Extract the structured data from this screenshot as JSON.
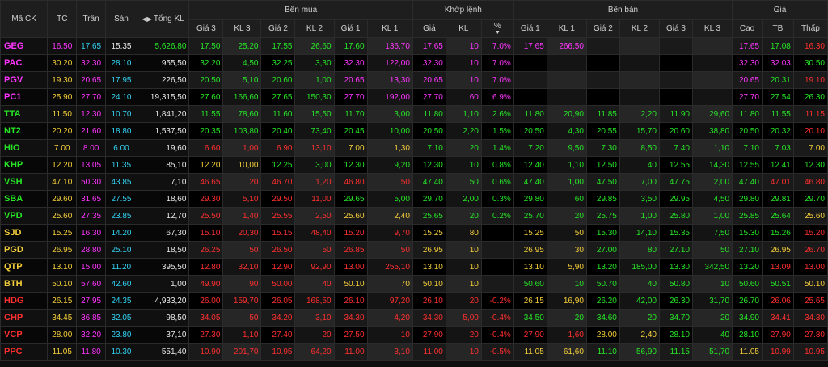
{
  "colors": {
    "ceiling": "#ff35ff",
    "down": "#ff2f2f",
    "up": "#26e626",
    "ref": "#f5cf3a",
    "floor": "#32d2f2"
  },
  "icons": {
    "sort": "sort-triangle-icon",
    "pct_sort": "arrow-down-icon"
  },
  "headers": {
    "symbol": "Mã CK",
    "tc": "TC",
    "tran": "Trần",
    "san": "Sàn",
    "tong_kl": "Tổng KL",
    "buy_group": "Bên mua",
    "match_group": "Khớp lệnh",
    "sell_group": "Bên bán",
    "price_group": "Giá",
    "buy": {
      "gia3": "Giá 3",
      "kl3": "KL 3",
      "gia2": "Giá 2",
      "kl2": "KL 2",
      "gia1": "Giá 1",
      "kl1": "KL 1"
    },
    "match": {
      "gia": "Giá",
      "kl": "KL",
      "pct": "%"
    },
    "sell": {
      "gia1": "Giá 1",
      "kl1": "KL 1",
      "gia2": "Giá 2",
      "kl2": "KL 2",
      "gia3": "Giá 3",
      "kl3": "KL 3"
    },
    "price": {
      "cao": "Cao",
      "tb": "TB",
      "thap": "Thấp"
    }
  },
  "rows": [
    {
      "sym": "GEG",
      "tc": "16.50",
      "tran": "17.65",
      "san": "15.35",
      "tkl": "5,626,80",
      "b3": "17.50",
      "bk3": "25,20",
      "b2": "17.55",
      "bk2": "26,60",
      "b1": "17.60",
      "bk1": "136,70",
      "mp": "17.65",
      "mk": "10",
      "pct": "7.0%",
      "s1": "17.65",
      "sk1": "266,50",
      "s2": "",
      "sk2": "",
      "s3": "",
      "sk3": "",
      "hi": "17.65",
      "avg": "17.08",
      "lo": "16.30",
      "cc": [
        "P",
        "P",
        "C",
        "W",
        "G",
        "G",
        "G",
        "G",
        "G",
        "G",
        "P",
        "P",
        "P",
        "P",
        "P",
        "P",
        "",
        "",
        "",
        "",
        "P",
        "G",
        "R"
      ]
    },
    {
      "sym": "PAC",
      "tc": "30.20",
      "tran": "32.30",
      "san": "28.10",
      "tkl": "955,50",
      "b3": "32.20",
      "bk3": "4,50",
      "b2": "32.25",
      "bk2": "3,30",
      "b1": "32.30",
      "bk1": "122,00",
      "mp": "32.30",
      "mk": "10",
      "pct": "7.0%",
      "s1": "",
      "sk1": "",
      "s2": "",
      "sk2": "",
      "s3": "",
      "sk3": "",
      "hi": "32.30",
      "avg": "32.03",
      "lo": "30.50",
      "cc": [
        "P",
        "Y",
        "P",
        "C",
        "W",
        "G",
        "G",
        "G",
        "G",
        "P",
        "P",
        "P",
        "P",
        "P",
        "",
        "",
        "",
        "",
        "",
        "",
        "P",
        "P",
        "G"
      ]
    },
    {
      "sym": "PGV",
      "tc": "19.30",
      "tran": "20.65",
      "san": "17.95",
      "tkl": "226,50",
      "b3": "20.50",
      "bk3": "5,10",
      "b2": "20.60",
      "bk2": "1,00",
      "b1": "20.65",
      "bk1": "13,30",
      "mp": "20.65",
      "mk": "10",
      "pct": "7.0%",
      "s1": "",
      "sk1": "",
      "s2": "",
      "sk2": "",
      "s3": "",
      "sk3": "",
      "hi": "20.65",
      "avg": "20.31",
      "lo": "19.10",
      "cc": [
        "P",
        "Y",
        "P",
        "C",
        "W",
        "G",
        "G",
        "G",
        "G",
        "P",
        "P",
        "P",
        "P",
        "P",
        "",
        "",
        "",
        "",
        "",
        "",
        "P",
        "G",
        "R"
      ]
    },
    {
      "sym": "PC1",
      "tc": "25.90",
      "tran": "27.70",
      "san": "24.10",
      "tkl": "19,315,50",
      "b3": "27.60",
      "bk3": "166,60",
      "b2": "27.65",
      "bk2": "150,30",
      "b1": "27.70",
      "bk1": "192,00",
      "mp": "27.70",
      "mk": "60",
      "pct": "6.9%",
      "s1": "",
      "sk1": "",
      "s2": "",
      "sk2": "",
      "s3": "",
      "sk3": "",
      "hi": "27.70",
      "avg": "27.54",
      "lo": "26.30",
      "cc": [
        "P",
        "Y",
        "P",
        "C",
        "W",
        "G",
        "G",
        "G",
        "G",
        "P",
        "P",
        "P",
        "P",
        "P",
        "",
        "",
        "",
        "",
        "",
        "",
        "P",
        "G",
        "G"
      ]
    },
    {
      "sym": "TTA",
      "tc": "11.50",
      "tran": "12.30",
      "san": "10.70",
      "tkl": "1,841,20",
      "b3": "11.55",
      "bk3": "78,60",
      "b2": "11.60",
      "bk2": "15,50",
      "b1": "11.70",
      "bk1": "3,00",
      "mp": "11.80",
      "mk": "1,10",
      "pct": "2.6%",
      "s1": "11.80",
      "sk1": "20,90",
      "s2": "11.85",
      "sk2": "2,20",
      "s3": "11.90",
      "sk3": "29,60",
      "hi": "11.80",
      "avg": "11.55",
      "lo": "11.15",
      "cc": [
        "G",
        "Y",
        "P",
        "C",
        "W",
        "G",
        "G",
        "G",
        "G",
        "G",
        "G",
        "G",
        "G",
        "G",
        "G",
        "G",
        "G",
        "G",
        "G",
        "G",
        "G",
        "G",
        "R"
      ]
    },
    {
      "sym": "NT2",
      "tc": "20.20",
      "tran": "21.60",
      "san": "18.80",
      "tkl": "1,537,50",
      "b3": "20.35",
      "bk3": "103,80",
      "b2": "20.40",
      "bk2": "73,40",
      "b1": "20.45",
      "bk1": "10,00",
      "mp": "20.50",
      "mk": "2,20",
      "pct": "1.5%",
      "s1": "20.50",
      "sk1": "4,30",
      "s2": "20.55",
      "sk2": "15,70",
      "s3": "20.60",
      "sk3": "38,80",
      "hi": "20.50",
      "avg": "20.32",
      "lo": "20.10",
      "cc": [
        "G",
        "Y",
        "P",
        "C",
        "W",
        "G",
        "G",
        "G",
        "G",
        "G",
        "G",
        "G",
        "G",
        "G",
        "G",
        "G",
        "G",
        "G",
        "G",
        "G",
        "G",
        "G",
        "R"
      ]
    },
    {
      "sym": "HIO",
      "tc": "7.00",
      "tran": "8.00",
      "san": "6.00",
      "tkl": "19,60",
      "b3": "6.60",
      "bk3": "1,00",
      "b2": "6.90",
      "bk2": "13,10",
      "b1": "7.00",
      "bk1": "1,30",
      "mp": "7.10",
      "mk": "20",
      "pct": "1.4%",
      "s1": "7.20",
      "sk1": "9,50",
      "s2": "7.30",
      "sk2": "8,50",
      "s3": "7.40",
      "sk3": "1,10",
      "hi": "7.10",
      "avg": "7.03",
      "lo": "7.00",
      "cc": [
        "G",
        "Y",
        "P",
        "C",
        "W",
        "R",
        "R",
        "R",
        "R",
        "Y",
        "Y",
        "G",
        "G",
        "G",
        "G",
        "G",
        "G",
        "G",
        "G",
        "G",
        "G",
        "G",
        "Y"
      ]
    },
    {
      "sym": "KHP",
      "tc": "12.20",
      "tran": "13.05",
      "san": "11.35",
      "tkl": "85,10",
      "b3": "12.20",
      "bk3": "10,00",
      "b2": "12.25",
      "bk2": "3,00",
      "b1": "12.30",
      "bk1": "9,20",
      "mp": "12.30",
      "mk": "10",
      "pct": "0.8%",
      "s1": "12.40",
      "sk1": "1,10",
      "s2": "12.50",
      "sk2": "40",
      "s3": "12.55",
      "sk3": "14,30",
      "hi": "12.55",
      "avg": "12.41",
      "lo": "12.30",
      "cc": [
        "G",
        "Y",
        "P",
        "C",
        "W",
        "Y",
        "Y",
        "G",
        "G",
        "G",
        "G",
        "G",
        "G",
        "G",
        "G",
        "G",
        "G",
        "G",
        "G",
        "G",
        "G",
        "G",
        "G"
      ]
    },
    {
      "sym": "VSH",
      "tc": "47.10",
      "tran": "50.30",
      "san": "43.85",
      "tkl": "7,10",
      "b3": "46.65",
      "bk3": "20",
      "b2": "46.70",
      "bk2": "1,20",
      "b1": "46.80",
      "bk1": "50",
      "mp": "47.40",
      "mk": "50",
      "pct": "0.6%",
      "s1": "47.40",
      "sk1": "1,00",
      "s2": "47.50",
      "sk2": "7,00",
      "s3": "47.75",
      "sk3": "2,00",
      "hi": "47.40",
      "avg": "47.01",
      "lo": "46.80",
      "cc": [
        "G",
        "Y",
        "P",
        "C",
        "W",
        "R",
        "R",
        "R",
        "R",
        "R",
        "R",
        "G",
        "G",
        "G",
        "G",
        "G",
        "G",
        "G",
        "G",
        "G",
        "G",
        "R",
        "R"
      ]
    },
    {
      "sym": "SBA",
      "tc": "29.60",
      "tran": "31.65",
      "san": "27.55",
      "tkl": "18,60",
      "b3": "29.30",
      "bk3": "5,10",
      "b2": "29.50",
      "bk2": "11,00",
      "b1": "29.65",
      "bk1": "5,00",
      "mp": "29.70",
      "mk": "2,00",
      "pct": "0.3%",
      "s1": "29.80",
      "sk1": "60",
      "s2": "29.85",
      "sk2": "3,50",
      "s3": "29.95",
      "sk3": "4,50",
      "hi": "29.80",
      "avg": "29.81",
      "lo": "29.70",
      "cc": [
        "G",
        "Y",
        "P",
        "C",
        "W",
        "R",
        "R",
        "R",
        "R",
        "G",
        "G",
        "G",
        "G",
        "G",
        "G",
        "G",
        "G",
        "G",
        "G",
        "G",
        "G",
        "G",
        "G"
      ]
    },
    {
      "sym": "VPD",
      "tc": "25.60",
      "tran": "27.35",
      "san": "23.85",
      "tkl": "12,70",
      "b3": "25.50",
      "bk3": "1,40",
      "b2": "25.55",
      "bk2": "2,50",
      "b1": "25.60",
      "bk1": "2,40",
      "mp": "25.65",
      "mk": "20",
      "pct": "0.2%",
      "s1": "25.70",
      "sk1": "20",
      "s2": "25.75",
      "sk2": "1,00",
      "s3": "25.80",
      "sk3": "1,00",
      "hi": "25.85",
      "avg": "25.64",
      "lo": "25.60",
      "cc": [
        "G",
        "Y",
        "P",
        "C",
        "W",
        "R",
        "R",
        "R",
        "R",
        "Y",
        "Y",
        "G",
        "G",
        "G",
        "G",
        "G",
        "G",
        "G",
        "G",
        "G",
        "G",
        "G",
        "Y"
      ]
    },
    {
      "sym": "SJD",
      "tc": "15.25",
      "tran": "16.30",
      "san": "14.20",
      "tkl": "67,30",
      "b3": "15.10",
      "bk3": "20,30",
      "b2": "15.15",
      "bk2": "48,40",
      "b1": "15.20",
      "bk1": "9,70",
      "mp": "15.25",
      "mk": "80",
      "pct": "",
      "s1": "15.25",
      "sk1": "50",
      "s2": "15.30",
      "sk2": "14,10",
      "s3": "15.35",
      "sk3": "7,50",
      "hi": "15.30",
      "avg": "15.26",
      "lo": "15.20",
      "cc": [
        "Y",
        "Y",
        "P",
        "C",
        "W",
        "R",
        "R",
        "R",
        "R",
        "R",
        "R",
        "Y",
        "Y",
        "Y",
        "Y",
        "Y",
        "G",
        "G",
        "G",
        "G",
        "G",
        "G",
        "R"
      ]
    },
    {
      "sym": "PGD",
      "tc": "26.95",
      "tran": "28.80",
      "san": "25.10",
      "tkl": "18,50",
      "b3": "26.25",
      "bk3": "50",
      "b2": "26.50",
      "bk2": "50",
      "b1": "26.85",
      "bk1": "50",
      "mp": "26.95",
      "mk": "10",
      "pct": "",
      "s1": "26.95",
      "sk1": "30",
      "s2": "27.00",
      "sk2": "80",
      "s3": "27.10",
      "sk3": "50",
      "hi": "27.10",
      "avg": "26.95",
      "lo": "26.70",
      "cc": [
        "Y",
        "Y",
        "P",
        "C",
        "W",
        "R",
        "R",
        "R",
        "R",
        "R",
        "R",
        "Y",
        "Y",
        "Y",
        "Y",
        "Y",
        "G",
        "G",
        "G",
        "G",
        "G",
        "Y",
        "R"
      ]
    },
    {
      "sym": "QTP",
      "tc": "13.10",
      "tran": "15.00",
      "san": "11.20",
      "tkl": "395,50",
      "b3": "12.80",
      "bk3": "32,10",
      "b2": "12.90",
      "bk2": "92,90",
      "b1": "13.00",
      "bk1": "255,10",
      "mp": "13.10",
      "mk": "10",
      "pct": "",
      "s1": "13.10",
      "sk1": "5,90",
      "s2": "13.20",
      "sk2": "185,00",
      "s3": "13.30",
      "sk3": "342,50",
      "hi": "13.20",
      "avg": "13.09",
      "lo": "13.00",
      "cc": [
        "Y",
        "Y",
        "P",
        "C",
        "W",
        "R",
        "R",
        "R",
        "R",
        "R",
        "R",
        "Y",
        "Y",
        "Y",
        "Y",
        "Y",
        "G",
        "G",
        "G",
        "G",
        "G",
        "R",
        "R"
      ]
    },
    {
      "sym": "BTH",
      "tc": "50.10",
      "tran": "57.60",
      "san": "42.60",
      "tkl": "1,00",
      "b3": "49.90",
      "bk3": "90",
      "b2": "50.00",
      "bk2": "40",
      "b1": "50.10",
      "bk1": "70",
      "mp": "50.10",
      "mk": "10",
      "pct": "",
      "s1": "50.60",
      "sk1": "10",
      "s2": "50.70",
      "sk2": "40",
      "s3": "50.80",
      "sk3": "10",
      "hi": "50.60",
      "avg": "50.51",
      "lo": "50.10",
      "cc": [
        "Y",
        "Y",
        "P",
        "C",
        "W",
        "R",
        "R",
        "R",
        "R",
        "Y",
        "Y",
        "Y",
        "Y",
        "Y",
        "G",
        "G",
        "G",
        "G",
        "G",
        "G",
        "G",
        "G",
        "Y"
      ]
    },
    {
      "sym": "HDG",
      "tc": "26.15",
      "tran": "27.95",
      "san": "24.35",
      "tkl": "4,933,20",
      "b3": "26.00",
      "bk3": "159,70",
      "b2": "26.05",
      "bk2": "168,50",
      "b1": "26.10",
      "bk1": "97,20",
      "mp": "26.10",
      "mk": "20",
      "pct": "-0.2%",
      "s1": "26.15",
      "sk1": "16,90",
      "s2": "26.20",
      "sk2": "42,00",
      "s3": "26.30",
      "sk3": "31,70",
      "hi": "26.70",
      "avg": "26.06",
      "lo": "25.65",
      "cc": [
        "R",
        "Y",
        "P",
        "C",
        "W",
        "R",
        "R",
        "R",
        "R",
        "R",
        "R",
        "R",
        "R",
        "R",
        "Y",
        "Y",
        "G",
        "G",
        "G",
        "G",
        "G",
        "R",
        "R"
      ]
    },
    {
      "sym": "CHP",
      "tc": "34.45",
      "tran": "36.85",
      "san": "32.05",
      "tkl": "98,50",
      "b3": "34.05",
      "bk3": "50",
      "b2": "34.20",
      "bk2": "3,10",
      "b1": "34.30",
      "bk1": "4,20",
      "mp": "34.30",
      "mk": "5,00",
      "pct": "-0.4%",
      "s1": "34.50",
      "sk1": "20",
      "s2": "34.60",
      "sk2": "20",
      "s3": "34.70",
      "sk3": "20",
      "hi": "34.90",
      "avg": "34.41",
      "lo": "34.30",
      "cc": [
        "R",
        "Y",
        "P",
        "C",
        "W",
        "R",
        "R",
        "R",
        "R",
        "R",
        "R",
        "R",
        "R",
        "R",
        "G",
        "G",
        "G",
        "G",
        "G",
        "G",
        "G",
        "R",
        "R"
      ]
    },
    {
      "sym": "VCP",
      "tc": "28.00",
      "tran": "32.20",
      "san": "23.80",
      "tkl": "37,10",
      "b3": "27.30",
      "bk3": "1,10",
      "b2": "27.40",
      "bk2": "20",
      "b1": "27.50",
      "bk1": "10",
      "mp": "27.90",
      "mk": "20",
      "pct": "-0.4%",
      "s1": "27.90",
      "sk1": "1,60",
      "s2": "28.00",
      "sk2": "2,40",
      "s3": "28.10",
      "sk3": "40",
      "hi": "28.10",
      "avg": "27.90",
      "lo": "27.80",
      "cc": [
        "R",
        "Y",
        "P",
        "C",
        "W",
        "R",
        "R",
        "R",
        "R",
        "R",
        "R",
        "R",
        "R",
        "R",
        "R",
        "R",
        "Y",
        "Y",
        "G",
        "G",
        "G",
        "R",
        "R"
      ]
    },
    {
      "sym": "PPC",
      "tc": "11.05",
      "tran": "11.80",
      "san": "10.30",
      "tkl": "551,40",
      "b3": "10.90",
      "bk3": "201,70",
      "b2": "10.95",
      "bk2": "64,20",
      "b1": "11.00",
      "bk1": "3,10",
      "mp": "11.00",
      "mk": "10",
      "pct": "-0.5%",
      "s1": "11.05",
      "sk1": "61,60",
      "s2": "11.10",
      "sk2": "56,90",
      "s3": "11.15",
      "sk3": "51,70",
      "hi": "11.05",
      "avg": "10.99",
      "lo": "10.95",
      "cc": [
        "R",
        "Y",
        "P",
        "C",
        "W",
        "R",
        "R",
        "R",
        "R",
        "R",
        "R",
        "R",
        "R",
        "R",
        "Y",
        "Y",
        "G",
        "G",
        "G",
        "G",
        "Y",
        "R",
        "R"
      ]
    }
  ]
}
